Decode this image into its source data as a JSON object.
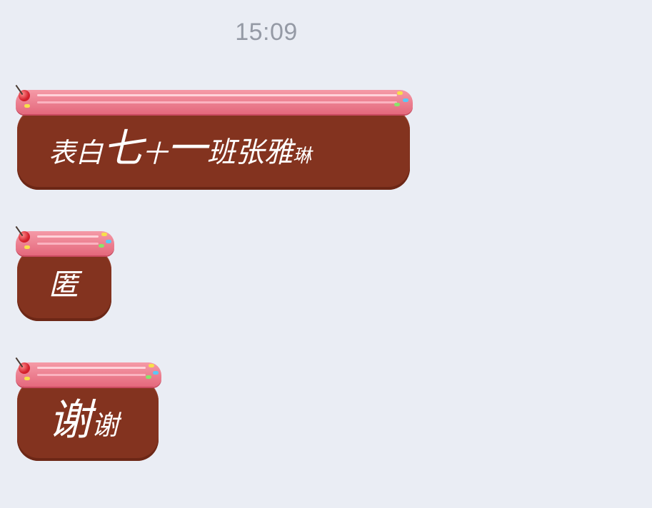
{
  "chat": {
    "timestamp": "15:09",
    "messages": [
      {
        "segments": [
          {
            "text": "表白",
            "size": 38
          },
          {
            "text": "七",
            "size": 56
          },
          {
            "text": "十",
            "size": 34
          },
          {
            "text": "一",
            "size": 56
          },
          {
            "text": "班张雅",
            "size": 40
          },
          {
            "text": "琳",
            "size": 26
          }
        ]
      },
      {
        "segments": [
          {
            "text": "匿",
            "size": 42
          }
        ]
      },
      {
        "segments": [
          {
            "text": "谢",
            "size": 60
          },
          {
            "text": "谢",
            "size": 38
          }
        ]
      }
    ]
  },
  "theme": {
    "background": "#eaedf4",
    "bubble_color": "#83331f",
    "frosting_color": "#e4687c",
    "timestamp_color": "#959aa5",
    "decoration_icons": [
      "cherry-icon",
      "sprinkles-icon"
    ]
  }
}
